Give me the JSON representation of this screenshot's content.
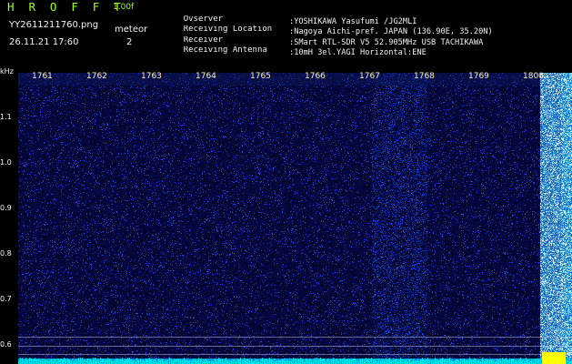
{
  "window": {
    "app_name": "H R O F F T",
    "version": "1.00f",
    "filename": "YY2611211760.png",
    "timestamp": "26.11.21 17:60",
    "meteor_label": "meteor",
    "meteor_count": "2"
  },
  "station": {
    "rows": [
      {
        "label": "Ovserver",
        "value": ":YOSHIKAWA Yasufumi /JG2MLI"
      },
      {
        "label": "Receiving Location",
        "value": ":Nagoya Aichi-pref. JAPAN (136.90E, 35.20N)"
      },
      {
        "label": "Receiver",
        "value": ":SMart RTL-SDR V5 52.905MHz USB TACHIKAWA"
      },
      {
        "label": "Receiving Antenna",
        "value": ":10mH 3el.YAGI Horizontal:ENE"
      }
    ]
  },
  "axes": {
    "unit": "kHz",
    "y_ticks": [
      "1.1",
      "1.0",
      "0.9",
      "0.8",
      "0.7",
      "0.6"
    ],
    "x_ticks": [
      "1761",
      "1762",
      "1763",
      "1764",
      "1765",
      "1766",
      "1767",
      "1768",
      "1769",
      "1800"
    ]
  },
  "display": {
    "background_color": "#000000",
    "brand_color": "#9cff1a",
    "text_color": "#f2f2f2",
    "time_label_color": "#fff4a8",
    "spectrogram_base_color": "#08051a",
    "spectrogram_noise_color": "#263cff",
    "spectrogram_hot_color": "#bfe8ff",
    "marker_color": "#ffff00"
  }
}
